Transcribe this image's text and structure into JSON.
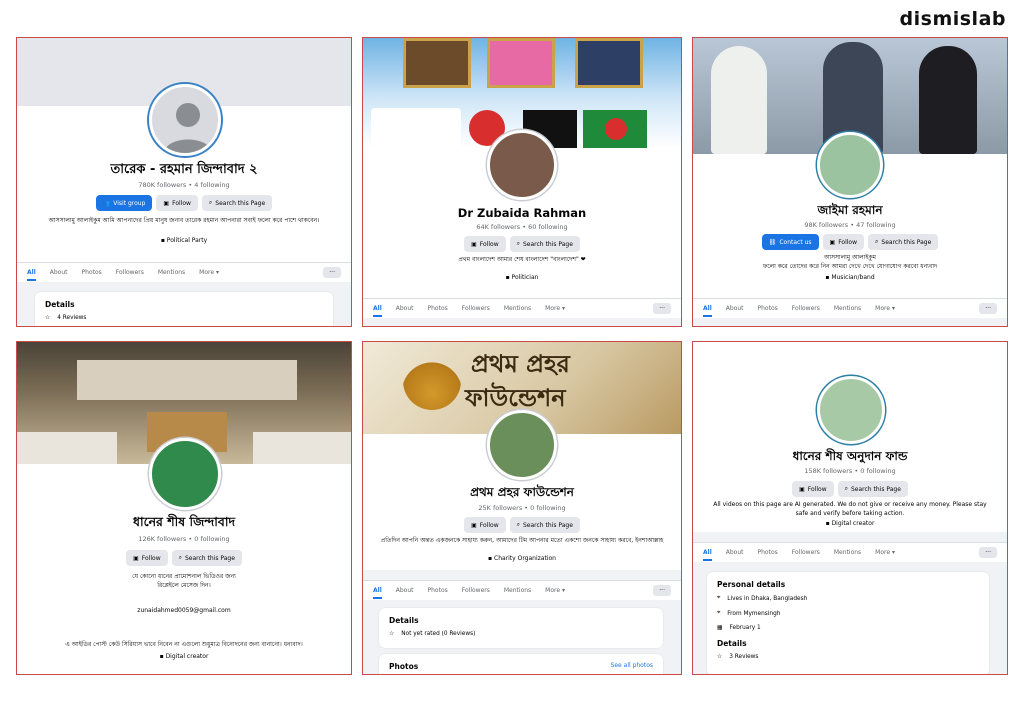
{
  "brand": "dismislab",
  "panels": {
    "p1": {
      "name": "তারেক - রহমান জিন্দাবাদ ২",
      "meta": "780K followers • 4 following",
      "btn1": "Visit group",
      "btn2": "Follow",
      "btn3": "Search this Page",
      "bio": "আসসালামু আলাইকুম আমি আপনাদের প্রিয় মানুষ জনাব তারেক রহমান আপনারা সবাই ফলো করে পাশে থাকবেন।",
      "category": "Political Party",
      "tabs": [
        "All",
        "About",
        "Photos",
        "Followers",
        "Mentions",
        "More ▾"
      ],
      "details_title": "Details",
      "reviews": "4 Reviews"
    },
    "p2": {
      "name": "Dr Zubaida Rahman",
      "meta": "64K followers • 60 following",
      "btn1": "Follow",
      "btn2": "Search this Page",
      "bio": "প্রথম বাংলাদেশ আমার শেষ বাংলাদেশ \"বাংলাদেশ\" ❤",
      "category": "Politician",
      "tabs": [
        "All",
        "About",
        "Photos",
        "Followers",
        "Mentions",
        "More ▾"
      ]
    },
    "p3": {
      "name": "জাইমা রহমান",
      "meta": "98K followers • 47 following",
      "btn1": "Contact us",
      "btn2": "Follow",
      "btn3": "Search this Page",
      "bio": "আসসালামু আলাইকুম\nফলো করে তোদের করে নিন আমরা দেখে দেখে যোগাযোগ করবো ধন্যবাদ",
      "category": "Musician/band",
      "tabs": [
        "All",
        "About",
        "Photos",
        "Followers",
        "Mentions",
        "More ▾"
      ]
    },
    "p4": {
      "name": "ধানের শীষ জিন্দাবাদ",
      "meta": "126K followers • 0 following",
      "btn1": "Follow",
      "btn2": "Search this Page",
      "bio": "যে কোনো ধানের প্রামোশনাল ভিডিওর জন্য\nরিপ্লেইলে মেসেজ দিন।",
      "email": "zunaidahmed0059@gmail.com",
      "bio2": "এ আইডির পোস্ট কেউ সিরিয়াস ভাবে নিবেন না এগুলো শুধুমাত্র বিনোদনের জন্য বানানো। ধন্যবাদ।",
      "category": "Digital creator"
    },
    "p5": {
      "banner_line1": "প্রথম প্রহর",
      "banner_line2": "ফাউন্ডেশন",
      "name": "প্রথম প্রহর ফাউন্ডেশন",
      "meta": "25K followers • 0 following",
      "btn1": "Follow",
      "btn2": "Search this Page",
      "bio": "প্রতিদিন আপনি অন্তত একজনকে সাহায্য করুন, আমাদের টিম আপনার মতো একশো জনকে সাহায্য করবে, ইনশাআল্লাহ",
      "category": "Charity Organization",
      "tabs": [
        "All",
        "About",
        "Photos",
        "Followers",
        "Mentions",
        "More ▾"
      ],
      "details_title": "Details",
      "rating": "Not yet rated (0 Reviews)",
      "photos_title": "Photos",
      "see_all": "See all photos"
    },
    "p6": {
      "name": "ধানের শীষ অনুদান ফান্ড",
      "meta": "158K followers • 0 following",
      "btn1": "Follow",
      "btn2": "Search this Page",
      "bio": "All videos on this page are AI generated. We do not give or receive any money. Please stay safe and verify before taking action.",
      "category": "Digital creator",
      "tabs": [
        "All",
        "About",
        "Photos",
        "Followers",
        "Mentions",
        "More ▾"
      ],
      "personal_title": "Personal details",
      "lives": "Lives in Dhaka, Bangladesh",
      "from": "From Mymensingh",
      "birthday": "February 1",
      "details_title": "Details",
      "reviews": "3 Reviews"
    }
  },
  "colors": {
    "accent": "#1b74e4",
    "frame": "#c94a4a",
    "bg": "#f0f2f5"
  }
}
